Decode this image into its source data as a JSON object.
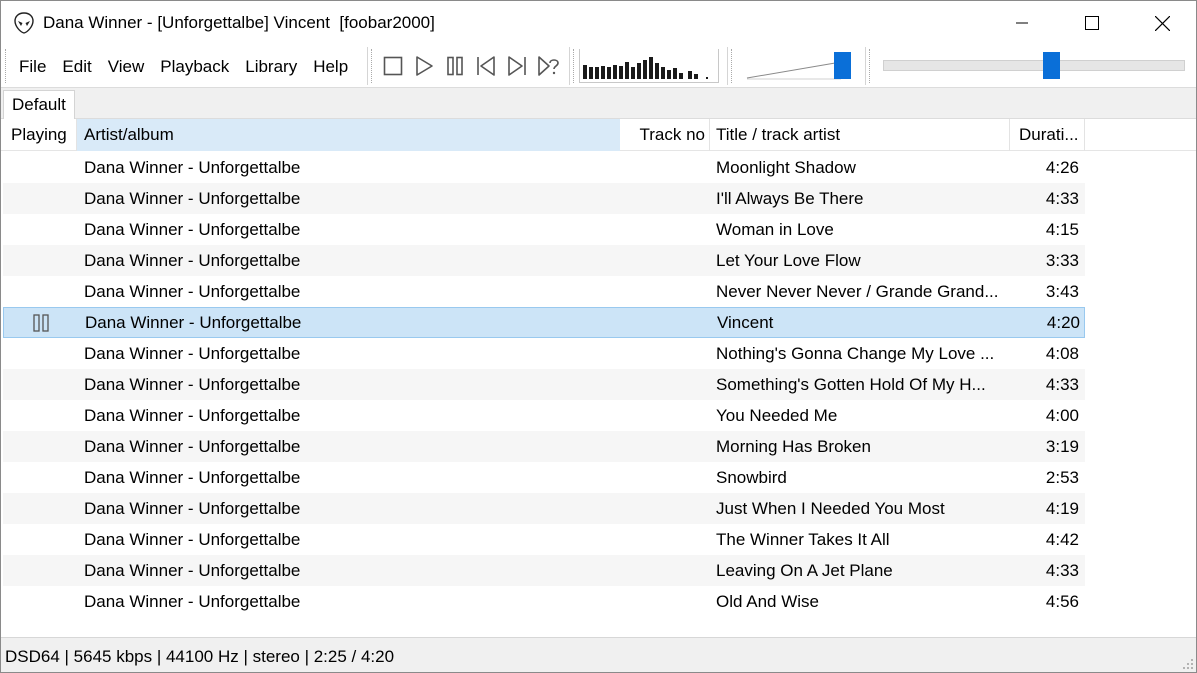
{
  "window": {
    "title": "Dana Winner - [Unforgettalbe] Vincent  [foobar2000]",
    "app_icon": "alien-icon",
    "controls": {
      "minimize": "minimize-icon",
      "maximize": "maximize-icon",
      "close": "close-icon"
    }
  },
  "menu": {
    "items": [
      {
        "label": "File"
      },
      {
        "label": "Edit"
      },
      {
        "label": "View"
      },
      {
        "label": "Playback"
      },
      {
        "label": "Library"
      },
      {
        "label": "Help"
      }
    ]
  },
  "transport": {
    "icons": [
      "stop-icon",
      "play-icon",
      "pause-icon",
      "previous-icon",
      "next-icon",
      "random-icon"
    ]
  },
  "accent_color": "#0a6fd8",
  "selection_color": "#cce4f7",
  "tabs": [
    {
      "label": "Default"
    }
  ],
  "playlist": {
    "columns": {
      "playing": "Playing",
      "artist": "Artist/album",
      "track": "Track no",
      "title": "Title / track artist",
      "duration": "Durati..."
    },
    "rows": [
      {
        "artist": "Dana Winner - Unforgettalbe",
        "title": "Moonlight Shadow",
        "duration": "4:26"
      },
      {
        "artist": "Dana Winner - Unforgettalbe",
        "title": "I'll Always Be There",
        "duration": "4:33"
      },
      {
        "artist": "Dana Winner - Unforgettalbe",
        "title": "Woman in Love",
        "duration": "4:15"
      },
      {
        "artist": "Dana Winner - Unforgettalbe",
        "title": "Let Your Love Flow",
        "duration": "3:33"
      },
      {
        "artist": "Dana Winner - Unforgettalbe",
        "title": "Never Never Never / Grande Grand...",
        "duration": "3:43"
      },
      {
        "artist": "Dana Winner - Unforgettalbe",
        "title": "Vincent",
        "duration": "4:20",
        "playing": true
      },
      {
        "artist": "Dana Winner - Unforgettalbe",
        "title": "Nothing's Gonna Change My Love ...",
        "duration": "4:08"
      },
      {
        "artist": "Dana Winner - Unforgettalbe",
        "title": "Something's Gotten Hold Of My H...",
        "duration": "4:33"
      },
      {
        "artist": "Dana Winner - Unforgettalbe",
        "title": "You Needed Me",
        "duration": "4:00"
      },
      {
        "artist": "Dana Winner - Unforgettalbe",
        "title": "Morning Has Broken",
        "duration": "3:19"
      },
      {
        "artist": "Dana Winner - Unforgettalbe",
        "title": "Snowbird",
        "duration": "2:53"
      },
      {
        "artist": "Dana Winner - Unforgettalbe",
        "title": "Just When I Needed You Most",
        "duration": "4:19"
      },
      {
        "artist": "Dana Winner - Unforgettalbe",
        "title": "The Winner Takes It All",
        "duration": "4:42"
      },
      {
        "artist": "Dana Winner - Unforgettalbe",
        "title": "Leaving On A Jet Plane",
        "duration": "4:33"
      },
      {
        "artist": "Dana Winner - Unforgettalbe",
        "title": "Old And Wise",
        "duration": "4:56"
      }
    ]
  },
  "volume": {
    "level": 0.95
  },
  "seek": {
    "position": 0.57
  },
  "status": {
    "text": "DSD64 | 5645 kbps | 44100 Hz | stereo | 2:25 / 4:20"
  }
}
